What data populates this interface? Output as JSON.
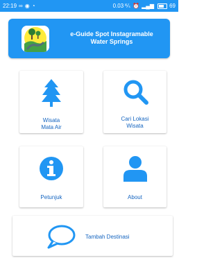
{
  "status_bar": {
    "time": "22:19",
    "network_speed": "0.03 ᴷ⁄ₛ",
    "battery": "69"
  },
  "header": {
    "title_line1": "e-Guide Spot Instagramable",
    "title_line2": "Water Springs"
  },
  "menu": {
    "wisata": {
      "label": "Wisata\nMata Air",
      "icon": "tree-icon"
    },
    "cari": {
      "label": "Cari Lokasi\nWisata",
      "icon": "search-icon"
    },
    "petunjuk": {
      "label": "Petunjuk",
      "icon": "info-icon"
    },
    "about": {
      "label": "About",
      "icon": "person-icon"
    },
    "tambah": {
      "label": "Tambah Destinasi",
      "icon": "chat-bubble-icon"
    }
  },
  "colors": {
    "primary": "#2196F3",
    "label": "#1565C0"
  }
}
